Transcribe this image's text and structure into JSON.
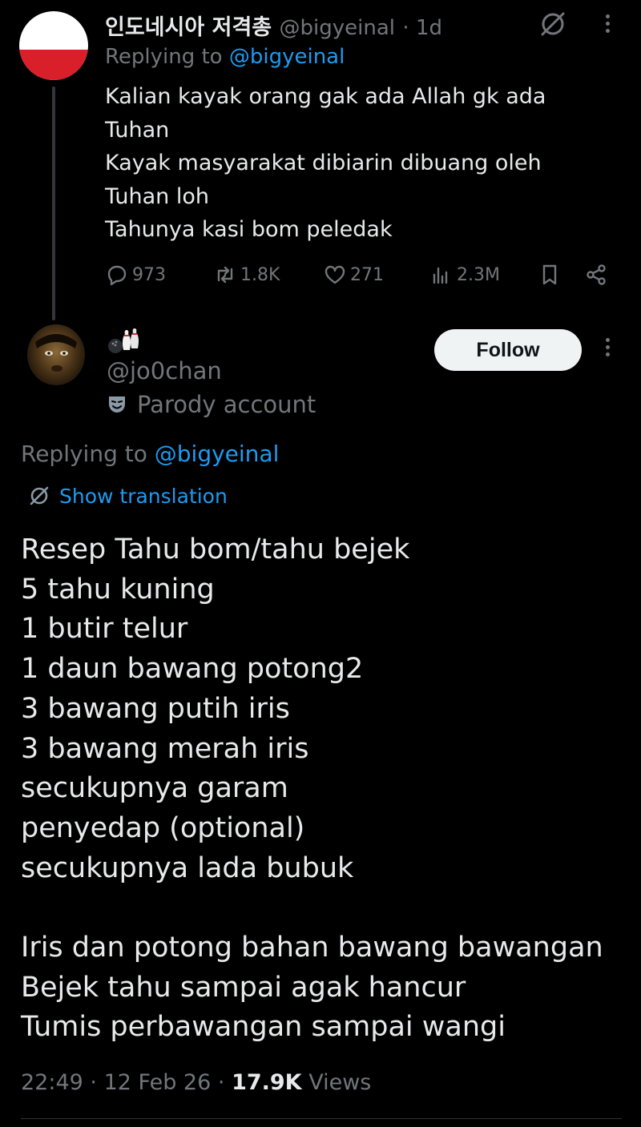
{
  "reply_tweet": {
    "display_name": "인도네시아 저격총",
    "handle": "@bigyeinal",
    "time": "· 1d",
    "replying_prefix": "Replying to ",
    "replying_handle": "@bigyeinal",
    "body": "Kalian kayak orang gak ada Allah gk ada\nTuhan\nKayak masyarakat dibiarin dibuang oleh\nTuhan loh\nTahunya kasi bom peledak",
    "stats": {
      "replies": "973",
      "reposts": "1.8K",
      "likes": "271",
      "views": "2.3M"
    }
  },
  "main_tweet": {
    "display_emoji": "🎳",
    "handle": "@jo0chan",
    "parody_label": "Parody account",
    "follow_label": "Follow",
    "replying_prefix": "Replying to ",
    "replying_handle": "@bigyeinal",
    "translate_label": "Show translation",
    "body": "Resep Tahu bom/tahu bejek\n5 tahu kuning\n1 butir telur\n1 daun bawang potong2\n3 bawang putih iris\n3 bawang merah iris\nsecukupnya garam\npenyedap (optional)\nsecukupnya lada bubuk\n\nIris dan potong bahan bawang bawangan\nBejek tahu sampai agak hancur\nTumis perbawangan sampai wangi",
    "time": "22:49",
    "date": "12 Feb 26",
    "views_count": "17.9K",
    "views_label": "Views"
  },
  "colors": {
    "background": "#000000",
    "text": "#e7e9ea",
    "muted": "#71767b",
    "link": "#1d9bf0"
  }
}
